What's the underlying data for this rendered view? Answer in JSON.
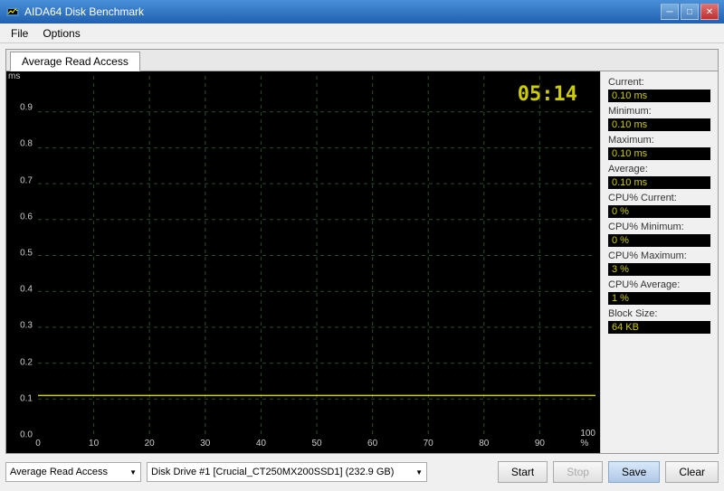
{
  "titleBar": {
    "title": "AIDA64 Disk Benchmark",
    "minimizeIcon": "─",
    "maximizeIcon": "□",
    "closeIcon": "✕"
  },
  "menuBar": {
    "items": [
      "File",
      "Options"
    ]
  },
  "tab": {
    "label": "Average Read Access"
  },
  "graph": {
    "timer": "05:14",
    "yAxisTitle": "ms",
    "yLabels": [
      "0.9",
      "0.8",
      "0.7",
      "0.6",
      "0.5",
      "0.4",
      "0.3",
      "0.2",
      "0.1",
      "0.0"
    ],
    "xLabels": [
      "0",
      "10",
      "20",
      "30",
      "40",
      "50",
      "60",
      "70",
      "80",
      "90",
      "100 %"
    ]
  },
  "stats": {
    "currentLabel": "Current:",
    "currentValue": "0.10 ms",
    "minimumLabel": "Minimum:",
    "minimumValue": "0.10 ms",
    "maximumLabel": "Maximum:",
    "maximumValue": "0.10 ms",
    "averageLabel": "Average:",
    "averageValue": "0.10 ms",
    "cpuCurrentLabel": "CPU% Current:",
    "cpuCurrentValue": "0 %",
    "cpuMinimumLabel": "CPU% Minimum:",
    "cpuMinimumValue": "0 %",
    "cpuMaximumLabel": "CPU% Maximum:",
    "cpuMaximumValue": "3 %",
    "cpuAverageLabel": "CPU% Average:",
    "cpuAverageValue": "1 %",
    "blockSizeLabel": "Block Size:",
    "blockSizeValue": "64 KB"
  },
  "bottomBar": {
    "benchmarkDropdown": "Average Read Access",
    "diskDropdown": "Disk Drive #1  [Crucial_CT250MX200SSD1]  (232.9 GB)",
    "startButton": "Start",
    "stopButton": "Stop",
    "saveButton": "Save",
    "clearButton": "Clear"
  }
}
